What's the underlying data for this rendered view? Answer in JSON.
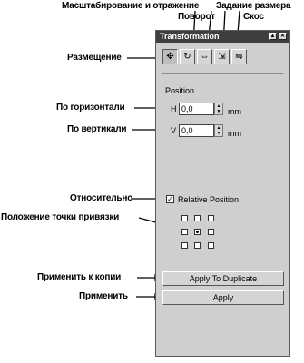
{
  "callouts": {
    "scale_mirror": "Масштабирование и отражение",
    "size": "Задание размера",
    "rotate": "Поворот",
    "skew": "Скос",
    "placement": "Размещение",
    "horizontal": "По горизонтали",
    "vertical": "По вертикали",
    "relative": "Относительно",
    "anchor_point": "Положение точки привязки",
    "apply_duplicate": "Применить к копии",
    "apply": "Применить"
  },
  "window": {
    "title": "Transformation",
    "pin_glyph": "▲",
    "close_glyph": "✕"
  },
  "toolbar": [
    {
      "name": "position-icon",
      "glyph": "✥"
    },
    {
      "name": "rotate-icon",
      "glyph": "↻"
    },
    {
      "name": "scale-mirror-icon",
      "glyph": "⇔"
    },
    {
      "name": "size-icon",
      "glyph": "⇲"
    },
    {
      "name": "skew-icon",
      "glyph": "⇋"
    }
  ],
  "position": {
    "heading": "Position",
    "h_label": "H",
    "h_value": "0,0",
    "v_label": "V",
    "v_value": "0,0",
    "unit": "mm",
    "relative_label": "Relative Position",
    "relative_checked": "✓",
    "anchor_selected": "center"
  },
  "buttons": {
    "apply_duplicate": "Apply To Duplicate",
    "apply": "Apply"
  }
}
